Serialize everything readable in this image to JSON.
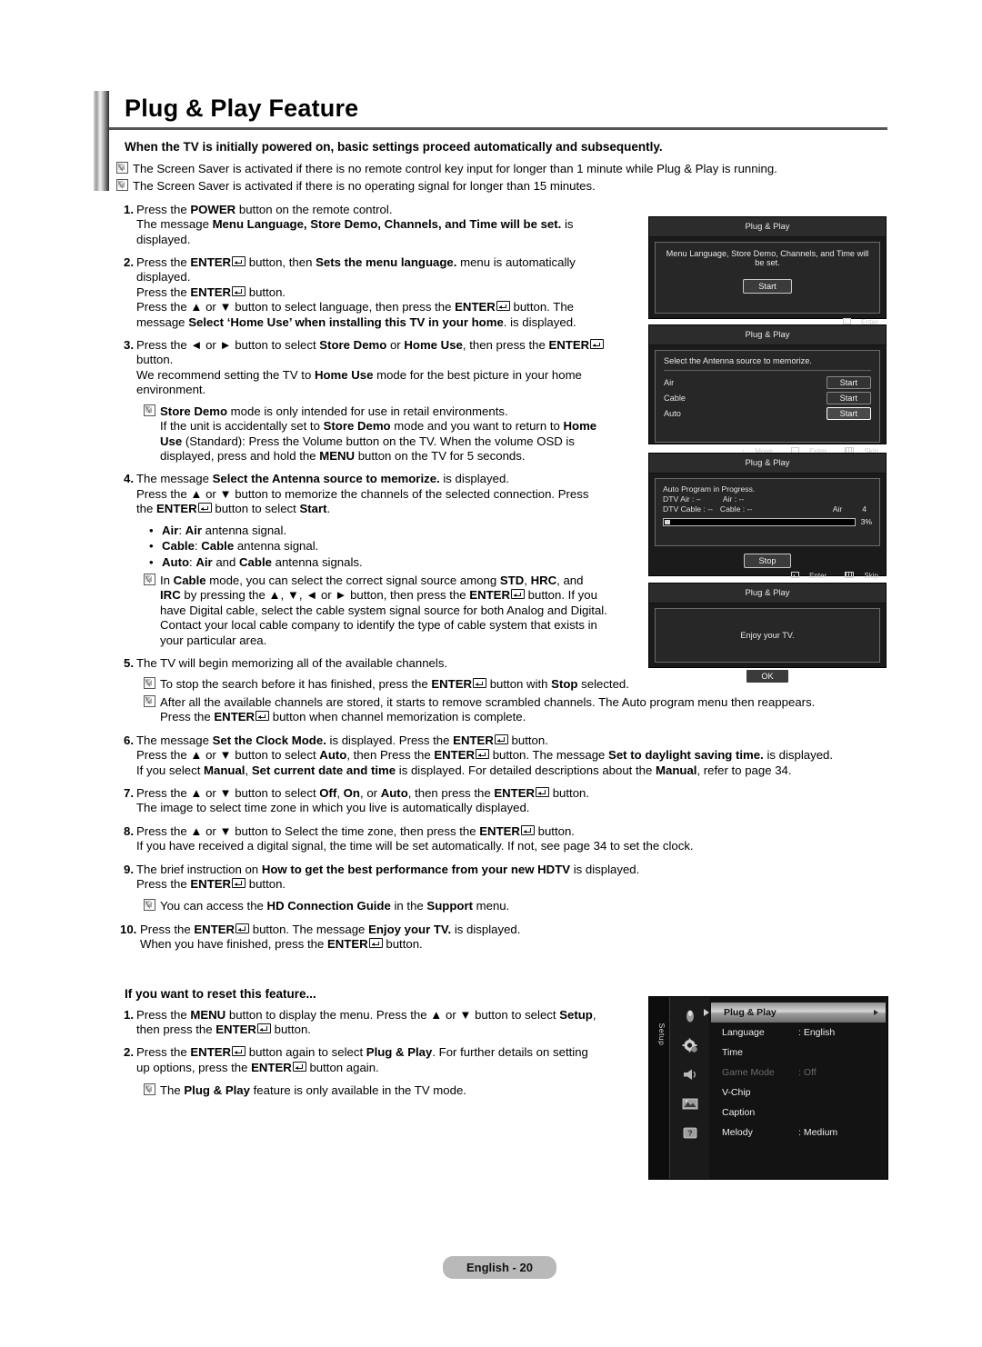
{
  "page": {
    "title": "Plug & Play Feature",
    "lead": "When the TV is initially powered on, basic settings proceed automatically and subsequently.",
    "footer": "English - 20"
  },
  "top_notes": [
    "The Screen Saver is activated if there is no remote control key input for longer than 1 minute while Plug & Play is running.",
    "The Screen Saver is activated if there is no operating signal for longer than 15 minutes."
  ],
  "steps": {
    "s1": {
      "num": "1.",
      "l1_a": "Press the ",
      "l1_b": "POWER",
      "l1_c": " button on the remote control.",
      "l2_a": "The message ",
      "l2_b": "Menu Language, Store Demo, Channels, and Time will be set.",
      "l2_c": " is",
      "l3": "displayed."
    },
    "s2": {
      "num": "2.",
      "l1_a": "Press the ",
      "l1_b": "ENTER",
      "l1_c": " button, then ",
      "l1_d": "Sets the menu language.",
      "l1_e": " menu is automatically",
      "l2": "displayed.",
      "l3_a": "Press the ",
      "l3_b": "ENTER",
      "l3_c": " button.",
      "l4_a": "Press the ▲ or ▼ button to select language, then press the ",
      "l4_b": "ENTER",
      "l4_c": " button. The",
      "l5_a": "message ",
      "l5_b": "Select ‘Home Use’ when installing this TV in your home",
      "l5_c": ". is displayed."
    },
    "s3": {
      "num": "3.",
      "l1_a": "Press the ◄ or ► button to select ",
      "l1_b": "Store Demo",
      "l1_c": " or ",
      "l1_d": "Home Use",
      "l1_e": ", then press the ",
      "l1_f": "ENTER",
      "l2": "button.",
      "l3_a": "We recommend setting the TV to ",
      "l3_b": "Home Use",
      "l3_c": " mode for the best picture in your home",
      "l4": "environment.",
      "note_l1_a": "Store Demo",
      "note_l1_b": " mode is only intended for use in retail environments.",
      "note_l2_a": "If the unit is accidentally set to ",
      "note_l2_b": "Store Demo",
      "note_l2_c": " mode and you want to return to ",
      "note_l2_d": "Home",
      "note_l3_a": "Use",
      "note_l3_b": " (Standard): Press the Volume button on the TV. When the volume OSD is",
      "note_l4_a": "displayed, press and hold the ",
      "note_l4_b": "MENU",
      "note_l4_c": " button on the TV for 5 seconds."
    },
    "s4": {
      "num": "4.",
      "l1_a": "The message ",
      "l1_b": "Select the Antenna source to memorize.",
      "l1_c": " is displayed.",
      "l2": "Press the ▲ or ▼ button to memorize the channels of the selected connection. Press",
      "l3_a": "the ",
      "l3_b": "ENTER",
      "l3_c": " button to select ",
      "l3_d": "Start",
      "l3_e": ".",
      "b1_a": "Air",
      "b1_b": ": ",
      "b1_c": "Air",
      "b1_d": " antenna signal.",
      "b2_a": "Cable",
      "b2_b": ": ",
      "b2_c": "Cable",
      "b2_d": " antenna signal.",
      "b3_a": "Auto",
      "b3_b": ": ",
      "b3_c": "Air",
      "b3_d": " and ",
      "b3_e": "Cable",
      "b3_f": " antenna signals.",
      "note_l1_a": "In ",
      "note_l1_b": "Cable",
      "note_l1_c": " mode, you can select the correct signal source among ",
      "note_l1_d": "STD",
      "note_l1_e": ", ",
      "note_l1_f": "HRC",
      "note_l1_g": ", and",
      "note_l2_a": "IRC",
      "note_l2_b": " by pressing the ▲, ▼, ◄ or ► button, then press the ",
      "note_l2_c": "ENTER",
      "note_l2_d": " button. If you",
      "note_l3": "have Digital cable, select the cable system signal source for both Analog and Digital.",
      "note_l4": "Contact your local cable company to identify the type of cable system that exists in",
      "note_l5": "your particular area."
    },
    "s5": {
      "num": "5.",
      "l1": "The TV will begin memorizing all of the available channels.",
      "note1_a": "To stop the search before it has finished, press the ",
      "note1_b": "ENTER",
      "note1_c": " button with ",
      "note1_d": "Stop",
      "note1_e": " selected.",
      "note2_l1": "After all the available channels are stored, it starts to remove scrambled channels. The Auto program menu then reappears.",
      "note2_l2_a": "Press the ",
      "note2_l2_b": "ENTER",
      "note2_l2_c": " button when channel memorization is complete."
    },
    "s6": {
      "num": "6.",
      "l1_a": "The message ",
      "l1_b": "Set the Clock Mode.",
      "l1_c": " is displayed. Press the ",
      "l1_d": "ENTER",
      "l1_e": " button.",
      "l2_a": "Press the ▲ or ▼ button to select ",
      "l2_b": "Auto",
      "l2_c": ", then Press the ",
      "l2_d": "ENTER",
      "l2_e": " button. The message ",
      "l2_f": "Set to daylight saving time.",
      "l2_g": " is displayed.",
      "l3_a": "If you select ",
      "l3_b": "Manual",
      "l3_c": ", ",
      "l3_d": "Set current date and time",
      "l3_e": " is displayed. For detailed descriptions about the ",
      "l3_f": "Manual",
      "l3_g": ", refer to page 34."
    },
    "s7": {
      "num": "7.",
      "l1_a": "Press the ▲ or ▼ button to select ",
      "l1_b": "Off",
      "l1_c": ", ",
      "l1_d": "On",
      "l1_e": ", or ",
      "l1_f": "Auto",
      "l1_g": ", then press the ",
      "l1_h": "ENTER",
      "l1_i": " button.",
      "l2": "The image to select time zone in which you live is automatically displayed."
    },
    "s8": {
      "num": "8.",
      "l1_a": "Press the ▲ or ▼ button to Select the time zone, then press the ",
      "l1_b": "ENTER",
      "l1_c": " button.",
      "l2": "If you have received a digital signal, the time will be set automatically. If not, see page 34 to set the clock."
    },
    "s9": {
      "num": "9.",
      "l1_a": "The brief instruction on ",
      "l1_b": "How to get the best performance from your new HDTV",
      "l1_c": " is displayed.",
      "l2_a": "Press the ",
      "l2_b": "ENTER",
      "l2_c": " button.",
      "note_a": "You can access the ",
      "note_b": "HD Connection Guide",
      "note_c": " in the ",
      "note_d": "Support",
      "note_e": " menu."
    },
    "s10": {
      "num": "10.",
      "l1_a": "Press the ",
      "l1_b": "ENTER",
      "l1_c": " button. The message ",
      "l1_d": "Enjoy your TV.",
      "l1_e": " is displayed.",
      "l2_a": "When you have finished, press the ",
      "l2_b": "ENTER",
      "l2_c": " button."
    }
  },
  "reset": {
    "heading": "If you want to reset this feature...",
    "r1": {
      "num": "1.",
      "l1_a": "Press the ",
      "l1_b": "MENU",
      "l1_c": " button to display the menu. Press the ▲ or ▼ button to select ",
      "l1_d": "Setup",
      "l1_e": ",",
      "l2_a": "then press the ",
      "l2_b": "ENTER",
      "l2_c": " button."
    },
    "r2": {
      "num": "2.",
      "l1_a": "Press the ",
      "l1_b": "ENTER",
      "l1_c": " button again to select ",
      "l1_d": "Plug & Play",
      "l1_e": ". For further details on setting",
      "l2_a": "up options, press the ",
      "l2_b": "ENTER",
      "l2_c": " button again.",
      "note_a": "The ",
      "note_b": "Plug & Play",
      "note_c": " feature is only available in the TV mode."
    }
  },
  "osd": {
    "panel1": {
      "title": "Plug & Play",
      "message": "Menu Language, Store Demo, Channels, and Time will be set.",
      "button": "Start",
      "foot_enter": "Enter"
    },
    "panel2": {
      "title": "Plug & Play",
      "message": "Select the Antenna source to memorize.",
      "rows": [
        {
          "label": "Air",
          "button": "Start"
        },
        {
          "label": "Cable",
          "button": "Start"
        },
        {
          "label": "Auto",
          "button": "Start"
        }
      ],
      "foot_move": "Move",
      "foot_enter": "Enter",
      "foot_skip": "Skip"
    },
    "panel3": {
      "title": "Plug & Play",
      "message": "Auto Program in Progress.",
      "line2_a": "DTV Air : –",
      "line2_b": "Air : --",
      "line3_a": "DTV Cable : --",
      "line3_b": "Cable : --",
      "line3_c": "Air",
      "line3_d": "4",
      "percent": "3%",
      "button": "Stop",
      "foot_enter": "Enter",
      "foot_skip": "Skip"
    },
    "panel4": {
      "title": "Plug & Play",
      "message": "Enjoy your TV.",
      "button": "OK"
    }
  },
  "setup_menu": {
    "tab_label": "Setup",
    "icons": [
      "input-icon",
      "gear-icon",
      "sound-icon",
      "picture-icon",
      "support-icon"
    ],
    "rows": [
      {
        "label": "Plug & Play",
        "value": "",
        "selected": true,
        "disabled": false
      },
      {
        "label": "Language",
        "value": ": English",
        "selected": false,
        "disabled": false
      },
      {
        "label": "Time",
        "value": "",
        "selected": false,
        "disabled": false
      },
      {
        "label": "Game Mode",
        "value": ": Off",
        "selected": false,
        "disabled": true
      },
      {
        "label": "V-Chip",
        "value": "",
        "selected": false,
        "disabled": false
      },
      {
        "label": "Caption",
        "value": "",
        "selected": false,
        "disabled": false
      },
      {
        "label": "Melody",
        "value": ": Medium",
        "selected": false,
        "disabled": false
      }
    ]
  }
}
